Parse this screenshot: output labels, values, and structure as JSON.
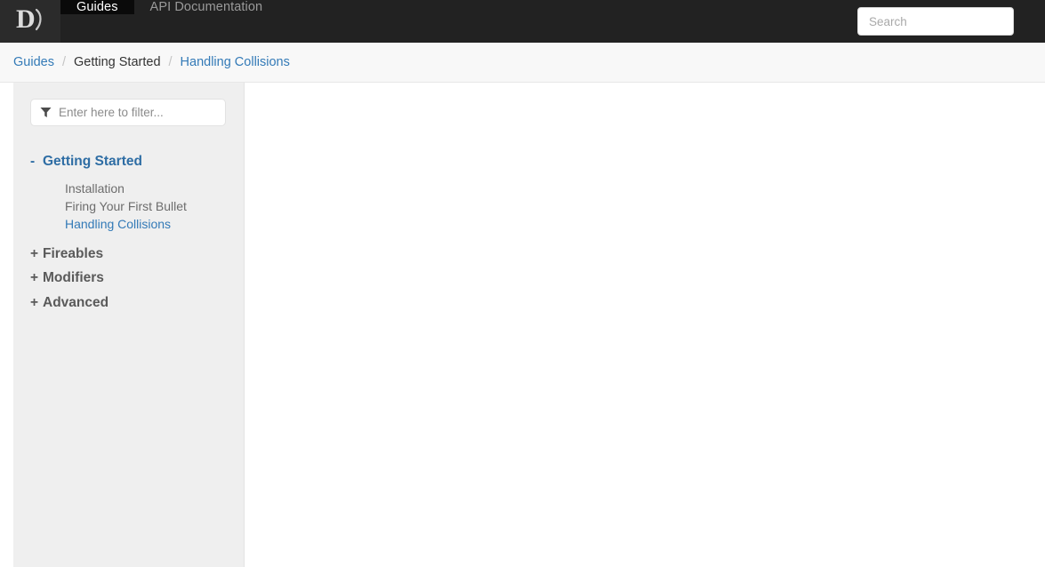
{
  "navbar": {
    "brand_icon": "letter-d-logo",
    "links": [
      {
        "label": "Guides",
        "active": true
      },
      {
        "label": "API Documentation",
        "active": false
      }
    ],
    "search": {
      "placeholder": "Search",
      "value": ""
    },
    "background_color": "#222222",
    "active_tab_color": "#0a0a0a"
  },
  "breadcrumb": {
    "items": [
      {
        "label": "Guides",
        "type": "link"
      },
      {
        "label": "Getting Started",
        "type": "current"
      },
      {
        "label": "Handling Collisions",
        "type": "link"
      }
    ],
    "separator": "/",
    "link_color": "#337ab7"
  },
  "sidebar": {
    "filter": {
      "icon": "funnel-filter-icon",
      "placeholder": "Enter here to filter...",
      "value": ""
    },
    "sections": [
      {
        "label": "Getting Started",
        "toggle": "-",
        "expanded": true,
        "children": [
          {
            "label": "Installation",
            "active": false
          },
          {
            "label": "Firing Your First Bullet",
            "active": false
          },
          {
            "label": "Handling Collisions",
            "active": true
          }
        ]
      },
      {
        "label": "Fireables",
        "toggle": "+",
        "expanded": false,
        "children": []
      },
      {
        "label": "Modifiers",
        "toggle": "+",
        "expanded": false,
        "children": []
      },
      {
        "label": "Advanced",
        "toggle": "+",
        "expanded": false,
        "children": []
      }
    ],
    "background_color": "#efefef",
    "active_color": "#337ab7"
  },
  "content": {
    "body_text": ""
  }
}
